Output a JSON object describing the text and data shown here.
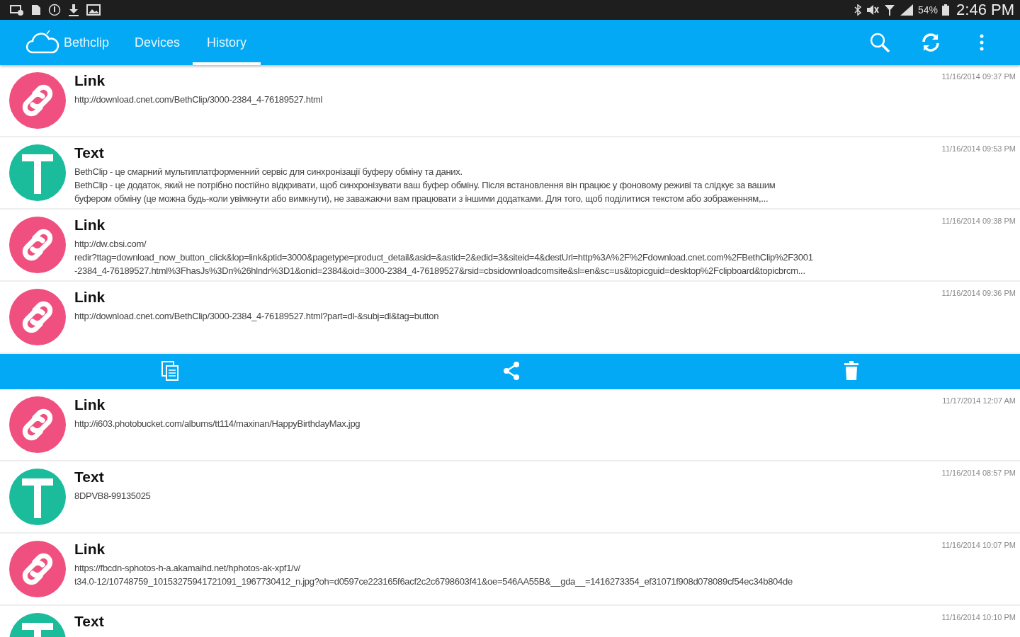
{
  "status_bar": {
    "battery": "54%",
    "time": "2:46 PM"
  },
  "app_bar": {
    "title": "Bethclip"
  },
  "tabs": [
    {
      "label": "Devices",
      "selected": false
    },
    {
      "label": "History",
      "selected": true
    }
  ],
  "history": [
    {
      "kind": "link",
      "title": "Link",
      "date": "11/16/2014 09:37 PM",
      "lines": [
        "http://download.cnet.com/BethClip/3000-2384_4-76189527.html"
      ],
      "expanded": false
    },
    {
      "kind": "text",
      "title": "Text",
      "date": "11/16/2014 09:53 PM",
      "lines": [
        "BethClip - це смарний мультиплатформенний сервіс для синхронізації буферу обміну та даних.",
        "BethClip - це додаток, який не потрібно постійно відкривати, щоб синхронізувати ваш буфер обміну. Після встановлення він працює у фоновому реживі та слідкує за вашим",
        "буфером обміну (це можна будь-коли увімкнути або вимкнути), не заважаючи вам працювати з іншими додатками. Для того, щоб поділитися текстом або зображенням,..."
      ],
      "expanded": false
    },
    {
      "kind": "link",
      "title": "Link",
      "date": "11/16/2014 09:38 PM",
      "lines": [
        "http://dw.cbsi.com/",
        "redir?ttag=download_now_button_click&lop=link&ptid=3000&pagetype=product_detail&asid=&astid=2&edid=3&siteid=4&destUrl=http%3A%2F%2Fdownload.cnet.com%2FBethClip%2F3001",
        "-2384_4-76189527.html%3FhasJs%3Dn%26hlndr%3D1&onid=2384&oid=3000-2384_4-76189527&rsid=cbsidownloadcomsite&sl=en&sc=us&topicguid=desktop%2Fclipboard&topicbrcm..."
      ],
      "expanded": false
    },
    {
      "kind": "link",
      "title": "Link",
      "date": "11/16/2014 09:36 PM",
      "lines": [
        "http://download.cnet.com/BethClip/3000-2384_4-76189527.html?part=dl-&subj=dl&tag=button"
      ],
      "expanded": true
    },
    {
      "kind": "link",
      "title": "Link",
      "date": "11/17/2014 12:07 AM",
      "lines": [
        "http://i603.photobucket.com/albums/tt114/maxinan/HappyBirthdayMax.jpg"
      ],
      "expanded": false
    },
    {
      "kind": "text",
      "title": "Text",
      "date": "11/16/2014 08:57 PM",
      "lines": [
        "8DPVB8-99135025"
      ],
      "expanded": false
    },
    {
      "kind": "link",
      "title": "Link",
      "date": "11/16/2014 10:07 PM",
      "lines": [
        "https://fbcdn-sphotos-h-a.akamaihd.net/hphotos-ak-xpf1/v/",
        "t34.0-12/10748759_10153275941721091_1967730412_n.jpg?oh=d0597ce223165f6acf2c2c6798603f41&oe=546AA55B&__gda__=1416273354_ef31071f908d078089cf54ec34b804de"
      ],
      "expanded": false
    },
    {
      "kind": "text",
      "title": "Text",
      "date": "11/16/2014 10:10 PM",
      "expanded": false
    }
  ]
}
